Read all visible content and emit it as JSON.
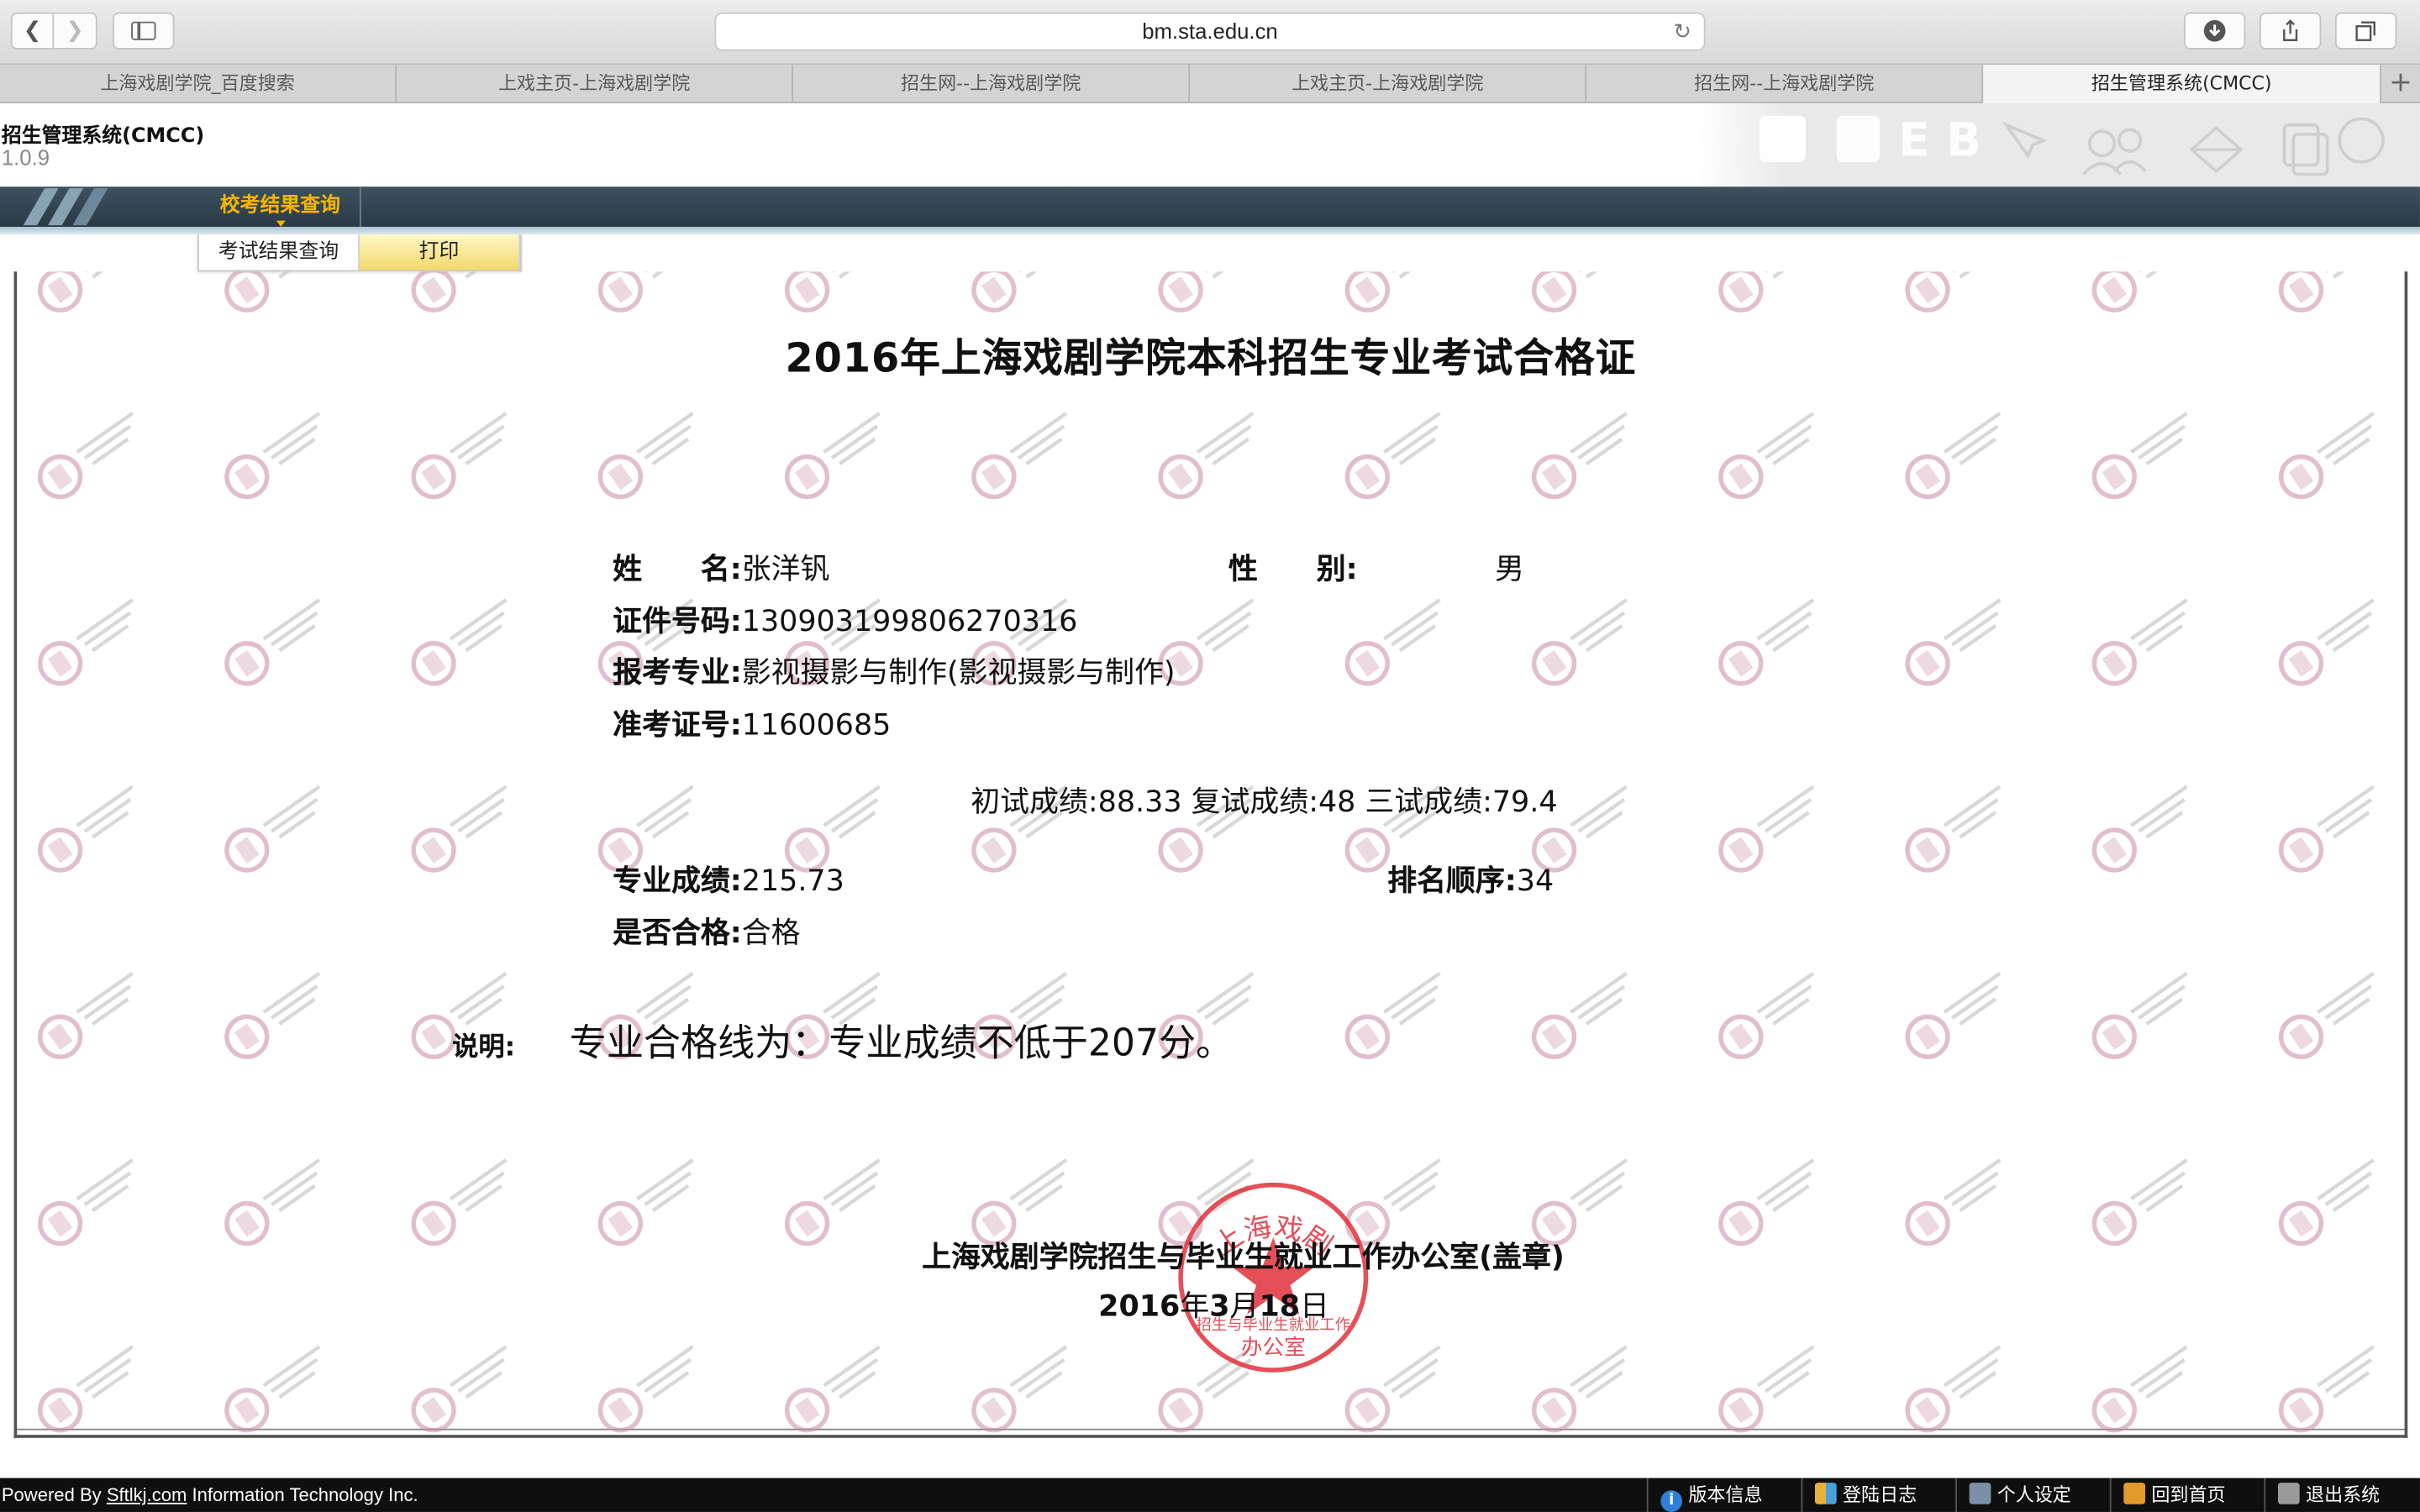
{
  "browser": {
    "url": "bm.sta.edu.cn",
    "tabs": [
      {
        "label": "上海戏剧学院_百度搜索"
      },
      {
        "label": "上戏主页-上海戏剧学院"
      },
      {
        "label": "招生网--上海戏剧学院"
      },
      {
        "label": "上戏主页-上海戏剧学院"
      },
      {
        "label": "招生网--上海戏剧学院"
      },
      {
        "label": "招生管理系统(CMCC)"
      }
    ],
    "new_tab_label": "+"
  },
  "app": {
    "title": "招生管理系统(CMCC)",
    "version": "1.0.9"
  },
  "nav": {
    "menu_label": "校考结果查询",
    "sub_items": [
      {
        "label": "考试结果查询"
      },
      {
        "label": "打印"
      }
    ]
  },
  "certificate": {
    "title": "2016年上海戏剧学院本科招生专业考试合格证",
    "name_label": "姓　　名:",
    "name": "张洋钒",
    "gender_label": "性　　别:",
    "gender": "男",
    "id_label": "证件号码:",
    "id_number": "130903199806270316",
    "major_label": "报考专业:",
    "major": "影视摄影与制作(影视摄影与制作)",
    "ticket_label": "准考证号:",
    "ticket_number": "11600685",
    "scores_line": "初试成绩:88.33 复试成绩:48 三试成绩:79.4",
    "pro_score_label": "专业成绩:",
    "pro_score": "215.73",
    "rank_label": "排名顺序:",
    "rank": "34",
    "pass_label": "是否合格:",
    "pass": "合格",
    "note_label": "说明:",
    "note": "专业合格线为：专业成绩不低于207分。",
    "office": "上海戏剧学院招生与毕业生就业工作办公室(盖章)",
    "date_parts": [
      "2016",
      "年",
      "3",
      "月",
      "18",
      "日"
    ],
    "seal_text_top": "上海戏剧",
    "seal_text_bottom": "招生与毕业生就业工作",
    "seal_text_last": "办公室"
  },
  "footer": {
    "powered_prefix": "Powered By ",
    "powered_link": "Sftlkj.com",
    "powered_suffix": " Information Technology Inc.",
    "buttons": [
      {
        "label": "版本信息",
        "icon": "info-icon"
      },
      {
        "label": "登陆日志",
        "icon": "users-icon"
      },
      {
        "label": "个人设定",
        "icon": "user-settings-icon"
      },
      {
        "label": "回到首页",
        "icon": "home-icon"
      },
      {
        "label": "退出系统",
        "icon": "logout-icon"
      }
    ]
  },
  "colors": {
    "nav_accent": "#f5b400",
    "nav_bg": "#33444f",
    "seal_red": "#e0303a",
    "watermark": "#c98aa8"
  }
}
